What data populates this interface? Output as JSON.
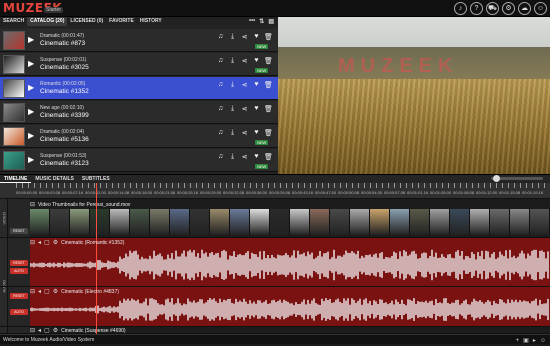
{
  "app": {
    "logo": "MUZEEK",
    "edition": "Starter"
  },
  "header_icons": [
    {
      "icon": "bell-icon",
      "glyph": "♪"
    },
    {
      "icon": "help-icon",
      "glyph": "?"
    },
    {
      "icon": "cart-icon",
      "glyph": "⛟"
    },
    {
      "icon": "settings-icon",
      "glyph": "⚙"
    },
    {
      "icon": "cloud-icon",
      "glyph": "☁"
    },
    {
      "icon": "user-icon",
      "glyph": "☺"
    }
  ],
  "tabs": [
    "SEARCH",
    "CATALOG (20)",
    "LICENSED (0)",
    "FAVORITE",
    "HISTORY"
  ],
  "active_tab": 1,
  "tab_tools": [
    "•••",
    "⇅",
    "▤"
  ],
  "tracks": [
    {
      "genre": "Dramatic (00:01:47)",
      "name": "Cinematic #873",
      "badge": "NEW",
      "thumb": "#6b6b6b",
      "thumb2": "#b5342e",
      "selected": false
    },
    {
      "genre": "Suspense (00:02:01)",
      "name": "Cinematic #3025",
      "badge": "NEW",
      "thumb": "#222222",
      "thumb2": "#dddddd",
      "selected": false
    },
    {
      "genre": "Romantic (00:02:05)",
      "name": "Cinematic #1352",
      "badge": "",
      "thumb": "#444444",
      "thumb2": "#ffffff",
      "selected": true
    },
    {
      "genre": "New age (00:02:10)",
      "name": "Cinematic #3399",
      "badge": "",
      "thumb": "#8a8a8a",
      "thumb2": "#333333",
      "selected": false
    },
    {
      "genre": "Dramatic (00:02:04)",
      "name": "Cinematic #5136",
      "badge": "NEW",
      "thumb": "#f2e6d8",
      "thumb2": "#c85a2a",
      "selected": false
    },
    {
      "genre": "Suspense (00:01:53)",
      "name": "Cinematic #3123",
      "badge": "NEW",
      "thumb": "#3aa089",
      "thumb2": "#1d5e52",
      "selected": false
    }
  ],
  "row_icons": [
    "♫",
    "⤓",
    "⋖",
    "♥",
    "🗑"
  ],
  "preview": {
    "watermark": "MUZEEK"
  },
  "subtabs": [
    "TIMELINE",
    "MUSIC DETAILS",
    "SUBTITLES"
  ],
  "active_subtab": 0,
  "zoom_level": 0.05,
  "ruler_labels": [
    "00:00:00.00",
    "00:00:03.08",
    "00:00:07.16",
    "00:00:11.00",
    "00:00:14.08",
    "00:00:18.00",
    "00:00:21.08",
    "00:00:25.16",
    "00:00:29.00",
    "00:00:32.08",
    "00:00:36.00",
    "00:00:39.08",
    "00:00:43.16",
    "00:00:47.00",
    "00:00:50.08",
    "00:00:54.00",
    "00:00:57.08",
    "00:01:01.16",
    "00:01:05.00",
    "00:01:08.08",
    "00:01:12.00",
    "00:01:15.08",
    "00:01:19.16"
  ],
  "lanes": {
    "video": {
      "label": "VIDEO",
      "title": "Video Thumbnails for Peressi_sound.mov",
      "reset": "RESET"
    },
    "audio1": {
      "label": "AUDIO",
      "reset": "RESET",
      "auto": "AUTO"
    },
    "audio2": {
      "label": "AUDIO",
      "reset": "RESET",
      "auto": "AUTO"
    }
  },
  "video_strip_colors": [
    "#6a8a6a",
    "#3d3d3d",
    "#8a9a7a",
    "#2a3a2a",
    "#bbbbbb",
    "#4a5a4a",
    "#7a7a6a",
    "#5a6a8a",
    "#333333",
    "#9a8a6a",
    "#6a7a9a",
    "#dddddd",
    "#2a2a2a",
    "#c8c8c8",
    "#8a6a5a",
    "#4a4a4a",
    "#aaaaaa",
    "#c9a46a",
    "#8aa0b0",
    "#5a5a4a",
    "#a0a0a0",
    "#3a4a5a",
    "#b0b0b0",
    "#6a6a6a",
    "#888888",
    "#555555"
  ],
  "audio_tracks": [
    {
      "title": "Cinematic (Romantic #1352)",
      "bg": "#7a1212",
      "wave": "#f2f2f2"
    },
    {
      "title": "Cinematic (Electro #4837)",
      "bg": "#7a1212",
      "wave": "#f2f2f2"
    },
    {
      "title": "Cinematic (Suspense #4690)",
      "bg": "#3d1515",
      "wave": "#aaaaaa"
    }
  ],
  "status_text": "Welcome to Muzeek Audio/Video System",
  "status_icons": [
    "+",
    "▣",
    "▸",
    "☺"
  ]
}
